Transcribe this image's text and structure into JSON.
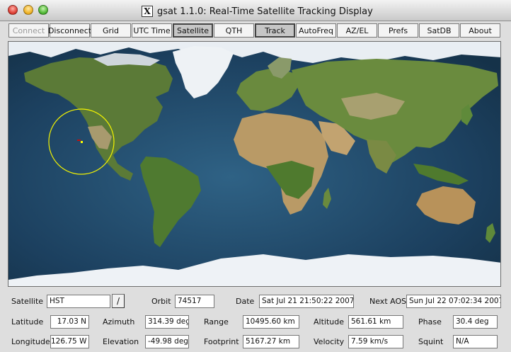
{
  "window": {
    "title": "gsat 1.1.0: Real-Time Satellite Tracking Display",
    "x_glyph": "X"
  },
  "toolbar": {
    "buttons": [
      {
        "label": "Connect",
        "state": "disabled"
      },
      {
        "label": "Disconnect",
        "state": "normal"
      },
      {
        "label": "Grid",
        "state": "normal"
      },
      {
        "label": "UTC Time",
        "state": "normal"
      },
      {
        "label": "Satellite",
        "state": "pressed"
      },
      {
        "label": "QTH",
        "state": "normal"
      },
      {
        "label": "Track",
        "state": "pressed"
      },
      {
        "label": "AutoFreq",
        "state": "normal"
      },
      {
        "label": "AZ/EL",
        "state": "normal"
      },
      {
        "label": "Prefs",
        "state": "normal"
      },
      {
        "label": "SatDB",
        "state": "normal"
      },
      {
        "label": "About",
        "state": "normal"
      }
    ]
  },
  "colors": {
    "footprint": "#f4f400",
    "satellite_marker": "#ffff00",
    "qth_marker": "#c01010",
    "ocean": "#1c405f",
    "land": "#5e7a36",
    "desert": "#b89a6a",
    "ice": "#eef2f6"
  },
  "info": {
    "satellite_label": "Satellite",
    "satellite_value": "HST",
    "select_glyph": "/",
    "orbit_label": "Orbit",
    "orbit_value": "74517",
    "date_label": "Date",
    "date_value": "Sat Jul 21 21:50:22 2007",
    "next_aos_label": "Next AOS",
    "next_aos_value": "Sun Jul 22 07:02:34 2007",
    "latitude_label": "Latitude",
    "latitude_value": "17.03 N",
    "azimuth_label": "Azimuth",
    "azimuth_value": "314.39 deg",
    "range_label": "Range",
    "range_value": "10495.60 km",
    "altitude_label": "Altitude",
    "altitude_value": "561.61 km",
    "phase_label": "Phase",
    "phase_value": "30.4 deg",
    "longitude_label": "Longitude",
    "longitude_value": "126.75 W",
    "elevation_label": "Elevation",
    "elevation_value": "-49.98 deg",
    "footprint_label": "Footprint",
    "footprint_value": "5167.27 km",
    "velocity_label": "Velocity",
    "velocity_value": "7.59 km/s",
    "squint_label": "Squint",
    "squint_value": "N/A"
  }
}
